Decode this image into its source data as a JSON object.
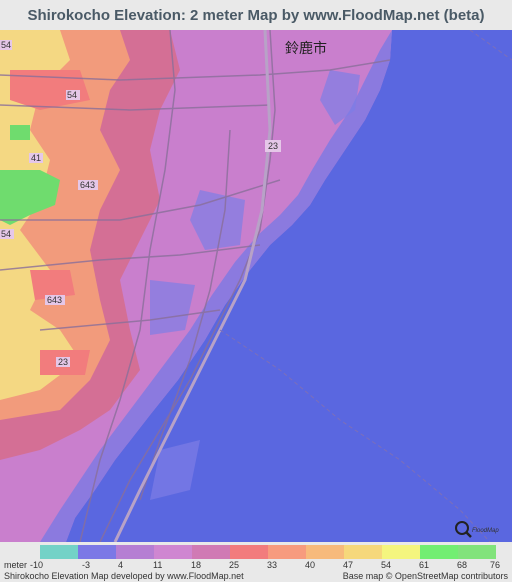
{
  "title": "Shirokocho Elevation: 2 meter Map by www.FloodMap.net (beta)",
  "map": {
    "city_label": "鈴鹿市",
    "route_labels": [
      "54",
      "54",
      "41",
      "643",
      "54",
      "23",
      "643",
      "23",
      "23"
    ],
    "colors": {
      "sea": "#5a67e0",
      "low": "#cf79c9",
      "mid": "#d36e8f",
      "high": "#f0a77b",
      "highest": "#f2e08a",
      "green": "#6fdc6e"
    }
  },
  "legend": {
    "unit_label": "meter",
    "values": [
      "-10",
      "-3",
      "4",
      "11",
      "18",
      "25",
      "33",
      "40",
      "47",
      "54",
      "61",
      "68",
      "76"
    ],
    "colors": [
      "#73d2c7",
      "#7b78e6",
      "#b57ed3",
      "#cf86d1",
      "#d07ab4",
      "#f27c7d",
      "#f79b7e",
      "#f7ba7c",
      "#f6d87b",
      "#f4f57e",
      "#72ee72",
      "#81e37b"
    ]
  },
  "footer": {
    "left": "Shirokocho Elevation Map developed by www.FloodMap.net",
    "right": "Base map © OpenStreetMap contributors"
  },
  "logo_text": "FloodMap"
}
